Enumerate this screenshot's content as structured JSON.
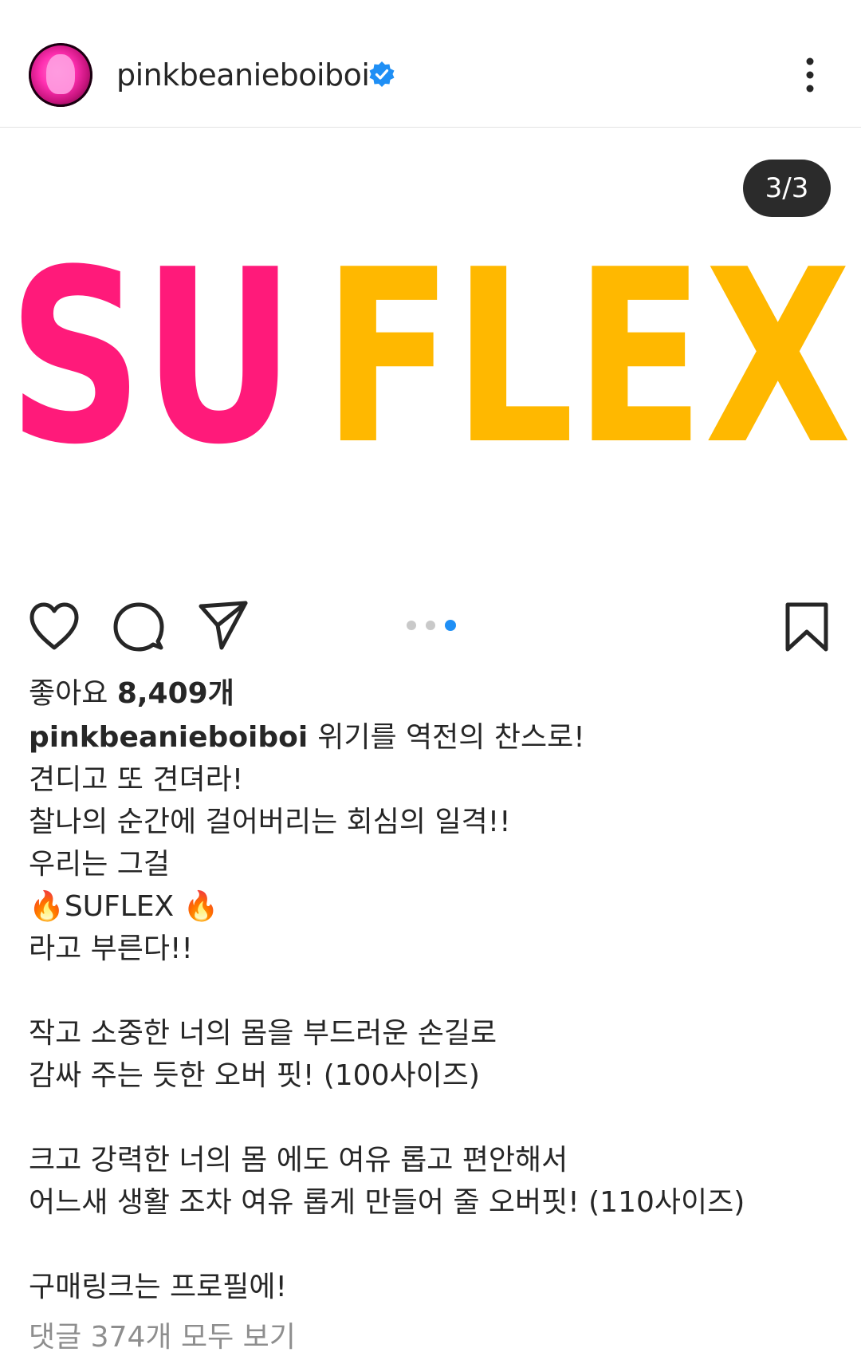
{
  "header": {
    "username": "pinkbeanieboiboi",
    "verified_icon": "verified-badge-icon",
    "more_icon": "more-vertical-icon",
    "avatar": "profile-avatar"
  },
  "media": {
    "page_counter": "3/3",
    "logo_text_part1": "SU",
    "logo_text_part2": "FLEX",
    "logo_color_part1": "#ff1a7a",
    "logo_color_part2": "#ffb800",
    "carousel_total": 3,
    "carousel_active": 3
  },
  "actions": {
    "like_icon": "heart-icon",
    "comment_icon": "comment-icon",
    "share_icon": "share-icon",
    "save_icon": "bookmark-icon"
  },
  "likes": {
    "prefix": "좋아요",
    "count": "8,409개"
  },
  "caption": {
    "username": "pinkbeanieboiboi",
    "lines": [
      "위기를 역전의 찬스로!",
      "견디고 또 견뎌라!",
      "찰나의 순간에 걸어버리는 회심의 일격!!",
      "우리는 그걸",
      "🔥SUFLEX 🔥",
      "라고 부른다!!",
      "",
      "작고 소중한 너의 몸을 부드러운 손길로",
      "감싸 주는 듯한 오버 핏! (100사이즈)",
      "",
      "크고 강력한 너의 몸 에도 여유 롭고 편안해서",
      "어느새 생활 조차 여유 롭게 만들어 줄 오버핏! (110사이즈)",
      "",
      "구매링크는 프로필에!"
    ]
  },
  "comments": {
    "view_all": "댓글 374개 모두 보기"
  },
  "colors": {
    "accent_blue": "#1f8ff5",
    "text_primary": "#262626",
    "text_secondary": "#8e8e8e"
  }
}
